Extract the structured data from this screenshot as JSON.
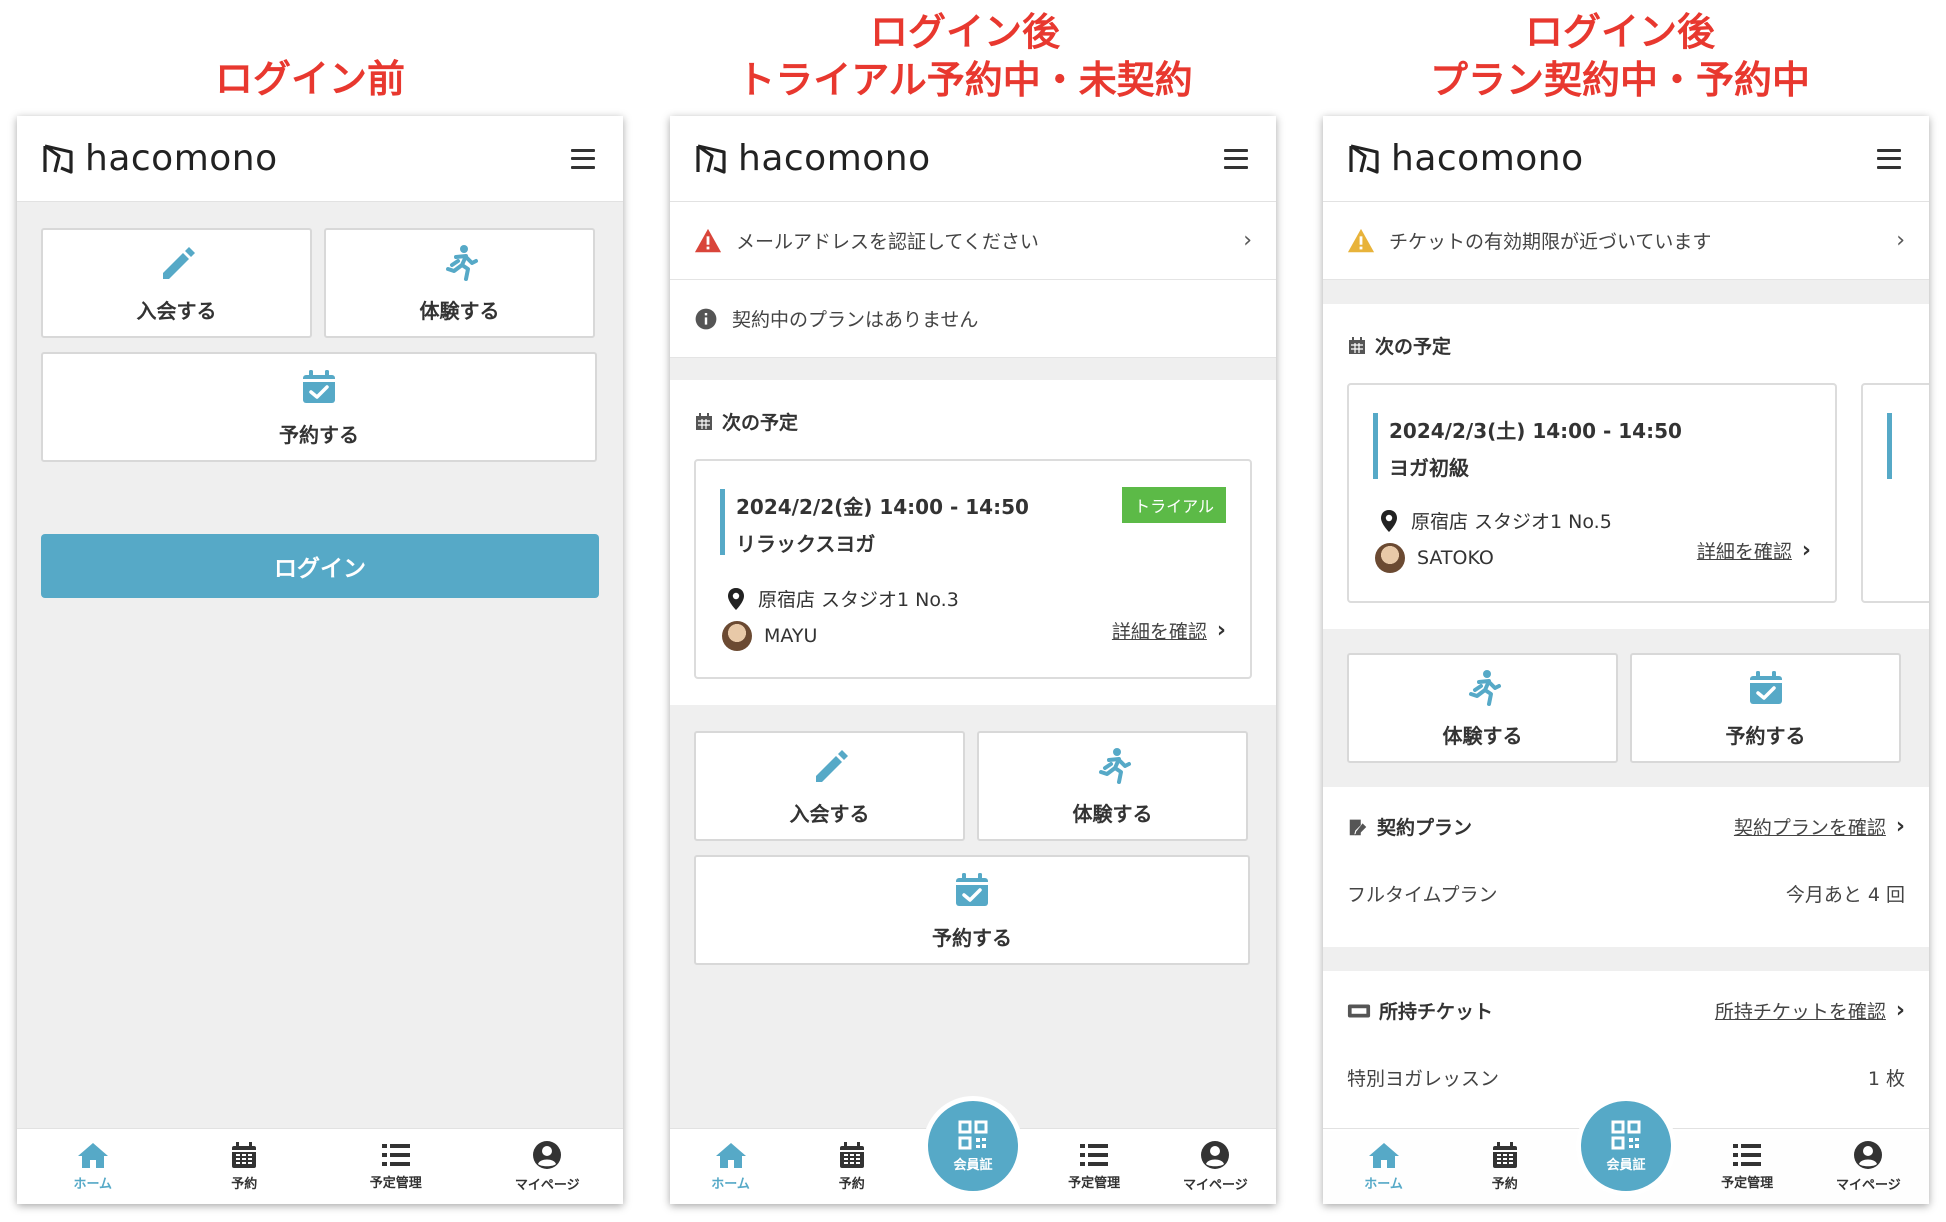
{
  "titles": {
    "col1_line1": "ログイン前",
    "col2_line1": "ログイン後",
    "col2_line2": "トライアル予約中・未契約",
    "col3_line1": "ログイン後",
    "col3_line2": "プラン契約中・予約中"
  },
  "brand": {
    "logo_text": "hacomono"
  },
  "actions": {
    "join": "入会する",
    "trial": "体験する",
    "reserve": "予約する",
    "login": "ログイン"
  },
  "notices": {
    "verify_email": "メールアドレスを認証してください",
    "no_plan": "契約中のプランはありません",
    "ticket_expiring": "チケットの有効期限が近づいています"
  },
  "schedule": {
    "section_title": "次の予定",
    "detail_link": "詳細を確認",
    "trial_card": {
      "datetime": "2024/2/2(金) 14:00 - 14:50",
      "class_name": "リラックスヨガ",
      "badge": "トライアル",
      "location": "原宿店 スタジオ1 No.3",
      "instructor": "MAYU"
    },
    "plan_card": {
      "datetime": "2024/2/3(土) 14:00 - 14:50",
      "class_name": "ヨガ初級",
      "location": "原宿店 スタジオ1 No.5",
      "instructor": "SATOKO"
    }
  },
  "plan": {
    "section_title": "契約プラン",
    "link": "契約プランを確認",
    "name": "フルタイムプラン",
    "remaining": "今月あと 4 回"
  },
  "tickets": {
    "section_title": "所持チケット",
    "link": "所持チケットを確認",
    "name": "特別ヨガレッスン",
    "count": "1 枚"
  },
  "tabs": {
    "home": "ホーム",
    "reserve": "予約",
    "schedule": "予定管理",
    "mypage": "マイページ",
    "member_card": "会員証"
  },
  "colors": {
    "accent": "#56a9c7",
    "title_red": "#e8382f",
    "trial_green": "#5cba47",
    "warning_red": "#d9453a",
    "warning_yellow": "#e8b33a"
  }
}
